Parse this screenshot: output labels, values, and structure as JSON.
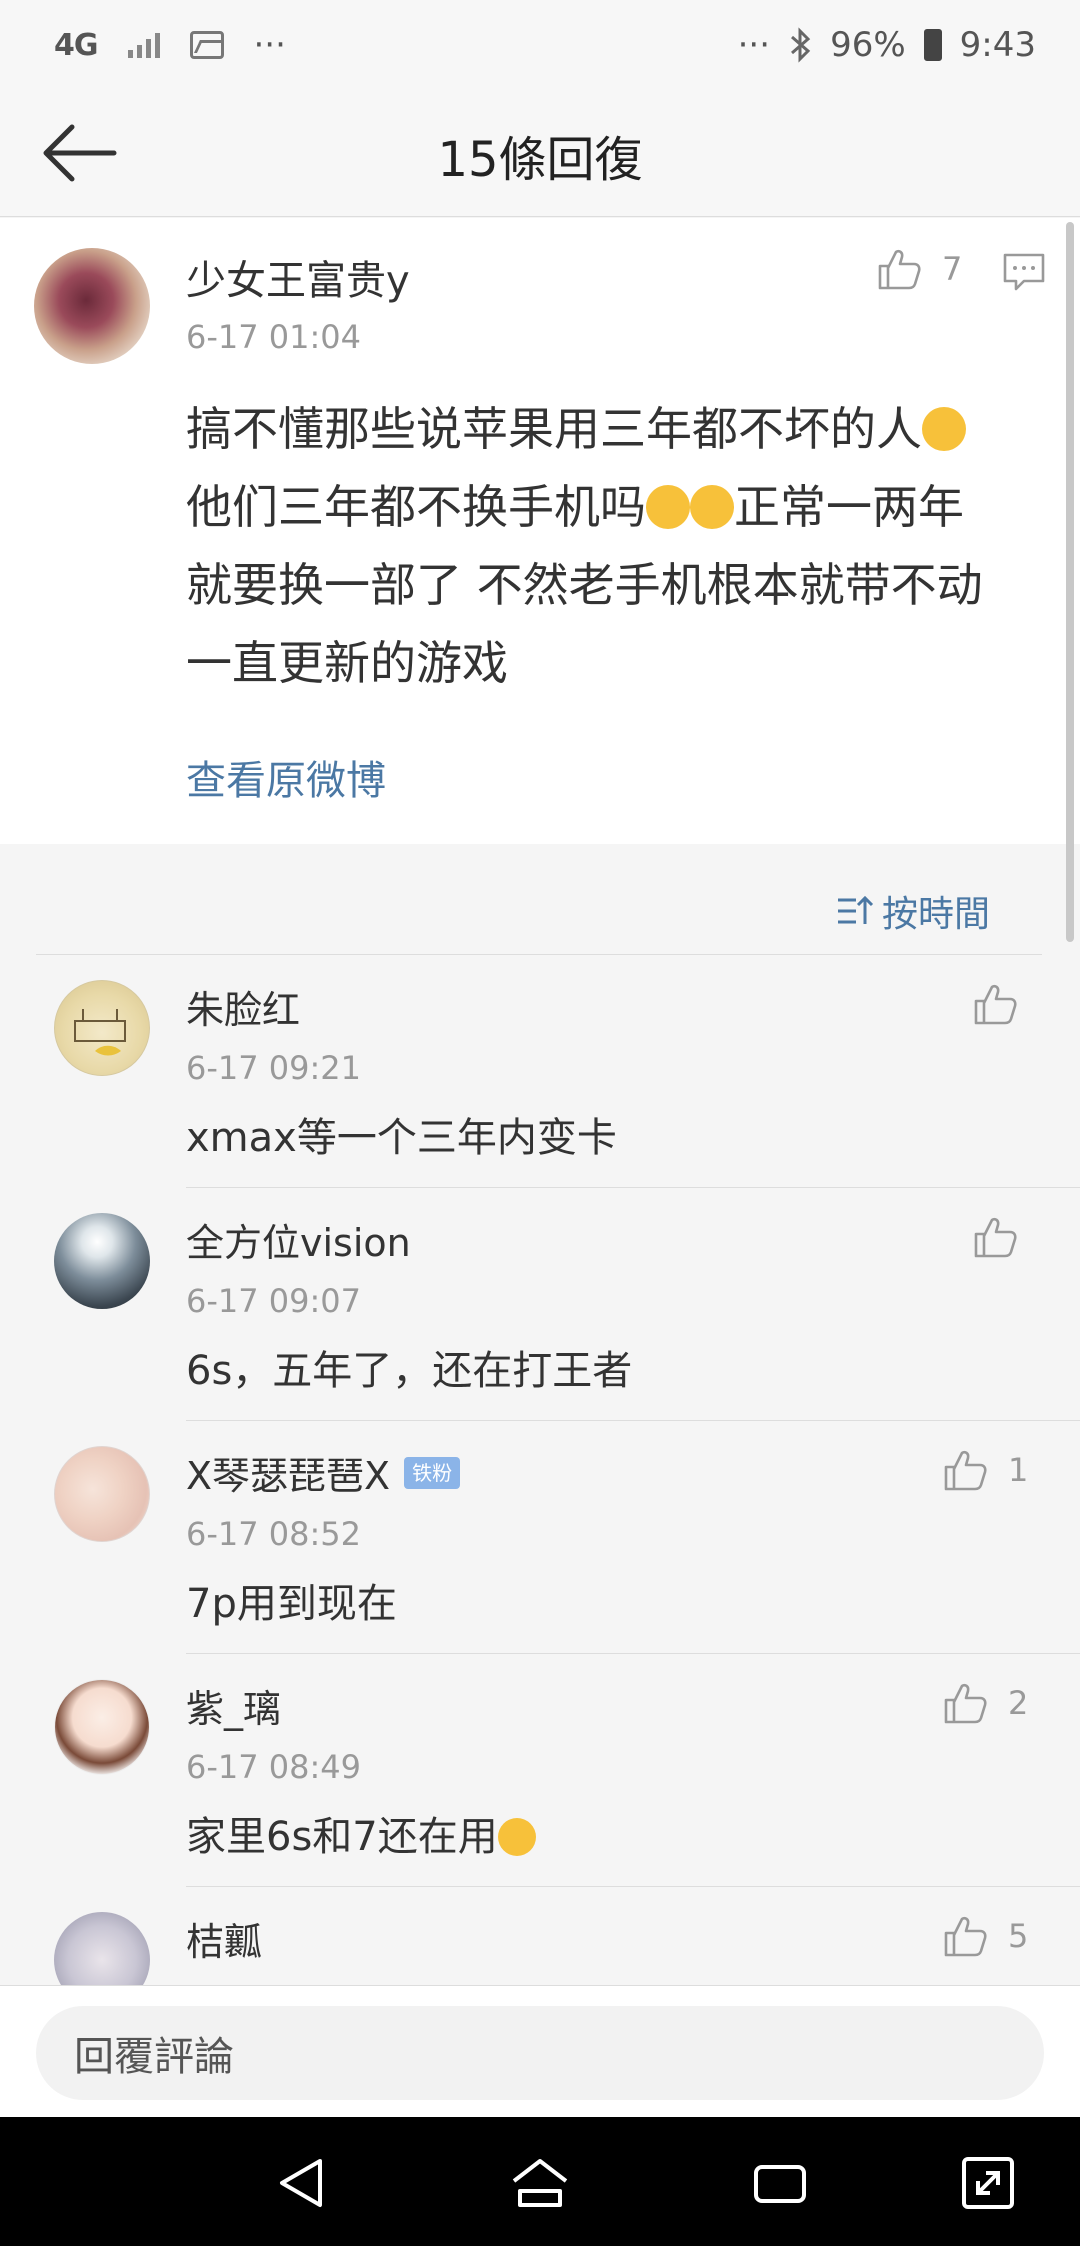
{
  "status_bar": {
    "network": "4G",
    "dots_left": "···",
    "dots_right": "···",
    "battery": "96%",
    "time": "9:43"
  },
  "header": {
    "title": "15條回復"
  },
  "post": {
    "author": "少女王富贵y",
    "time": "6-17 01:04",
    "likes": "7",
    "text_line1": "搞不懂那些说苹果用三年都不坏的人",
    "text_line2a": "他们三年都不换手机吗",
    "text_line2b": "正常一两年",
    "text_line3": "就要换一部了 不然老手机根本就带不动",
    "text_line4": "一直更新的游戏",
    "view_original": "查看原微博"
  },
  "sort": {
    "label": "按時間"
  },
  "comments": [
    {
      "name": "朱脸红",
      "time": "6-17 09:21",
      "text": "xmax等一个三年内变卡",
      "likes": ""
    },
    {
      "name": "全方位vision",
      "time": "6-17 09:07",
      "text": "6s，五年了，还在打王者",
      "likes": ""
    },
    {
      "name": "X琴瑟琵琶X",
      "badge": "铁粉",
      "time": "6-17 08:52",
      "text": "7p用到现在",
      "likes": "1"
    },
    {
      "name": "紫_璃",
      "time": "6-17 08:49",
      "text": "家里6s和7还在用",
      "likes": "2"
    },
    {
      "name": "桔瓤",
      "time": "",
      "text": "",
      "likes": "5"
    }
  ],
  "reply": {
    "placeholder": "回覆評論"
  },
  "colors": {
    "link": "#4b78a4",
    "muted": "#999999",
    "badge": "#8bb4e8"
  }
}
